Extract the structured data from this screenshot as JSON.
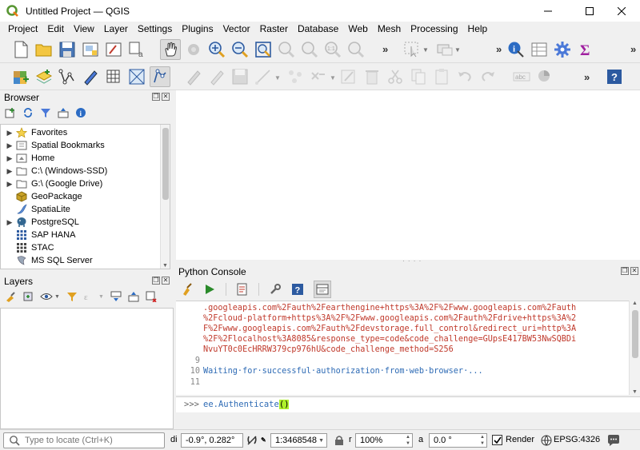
{
  "window": {
    "title": "Untitled Project — QGIS"
  },
  "menu": [
    "Project",
    "Edit",
    "View",
    "Layer",
    "Settings",
    "Plugins",
    "Vector",
    "Raster",
    "Database",
    "Web",
    "Mesh",
    "Processing",
    "Help"
  ],
  "browser": {
    "title": "Browser",
    "items": [
      {
        "label": "Favorites",
        "icon": "star-icon",
        "expandable": true
      },
      {
        "label": "Spatial Bookmarks",
        "icon": "bookmark-icon",
        "expandable": true
      },
      {
        "label": "Home",
        "icon": "home-folder-icon",
        "expandable": true
      },
      {
        "label": "C:\\ (Windows-SSD)",
        "icon": "drive-icon",
        "expandable": true
      },
      {
        "label": "G:\\ (Google Drive)",
        "icon": "drive-icon",
        "expandable": true
      },
      {
        "label": "GeoPackage",
        "icon": "geopackage-icon",
        "expandable": false
      },
      {
        "label": "SpatiaLite",
        "icon": "spatialite-icon",
        "expandable": false
      },
      {
        "label": "PostgreSQL",
        "icon": "postgresql-icon",
        "expandable": true
      },
      {
        "label": "SAP HANA",
        "icon": "sap-hana-icon",
        "expandable": false
      },
      {
        "label": "STAC",
        "icon": "stac-icon",
        "expandable": false
      },
      {
        "label": "MS SQL Server",
        "icon": "mssql-icon",
        "expandable": false
      }
    ]
  },
  "layers": {
    "title": "Layers"
  },
  "python_console": {
    "title": "Python Console",
    "lines": [
      {
        "num": "",
        "text": ".googleapis.com%2Fauth%2Fearthengine+https%3A%2F%2Fwww.googleapis.com%2Fauth",
        "color": "red"
      },
      {
        "num": "",
        "text": "%2Fcloud-platform+https%3A%2F%2Fwww.googleapis.com%2Fauth%2Fdrive+https%3A%2",
        "color": "red"
      },
      {
        "num": "",
        "text": "F%2Fwww.googleapis.com%2Fauth%2Fdevstorage.full_control&redirect_uri=http%3A",
        "color": "red"
      },
      {
        "num": "",
        "text": "%2F%2Flocalhost%3A8085&response_type=code&code_challenge=GUpsE417BW53NwSQBDi",
        "color": "red"
      },
      {
        "num": "",
        "text": "NvuYT0c0EcHRRW379cp976hU&code_challenge_method=S256",
        "color": "red"
      },
      {
        "num": "9",
        "text": "",
        "color": "red"
      },
      {
        "num": "10",
        "text": "Waiting·for·successful·authorization·from·web·browser·...",
        "color": "blue"
      },
      {
        "num": "11",
        "text": "",
        "color": "red"
      }
    ],
    "prompt": ">>>",
    "command": "ee.Authenticate",
    "command_parens": "()"
  },
  "status": {
    "locate_placeholder": "Type to locate (Ctrl+K)",
    "coord_label": "di",
    "coordinate": "-0.9°, 0.282°",
    "scale": "1:3468548",
    "magnifier": "100%",
    "rotation_label": "r",
    "rotation_label2": "a",
    "rotation": "0.0 °",
    "render_label": "Render",
    "crs": "EPSG:4326"
  }
}
